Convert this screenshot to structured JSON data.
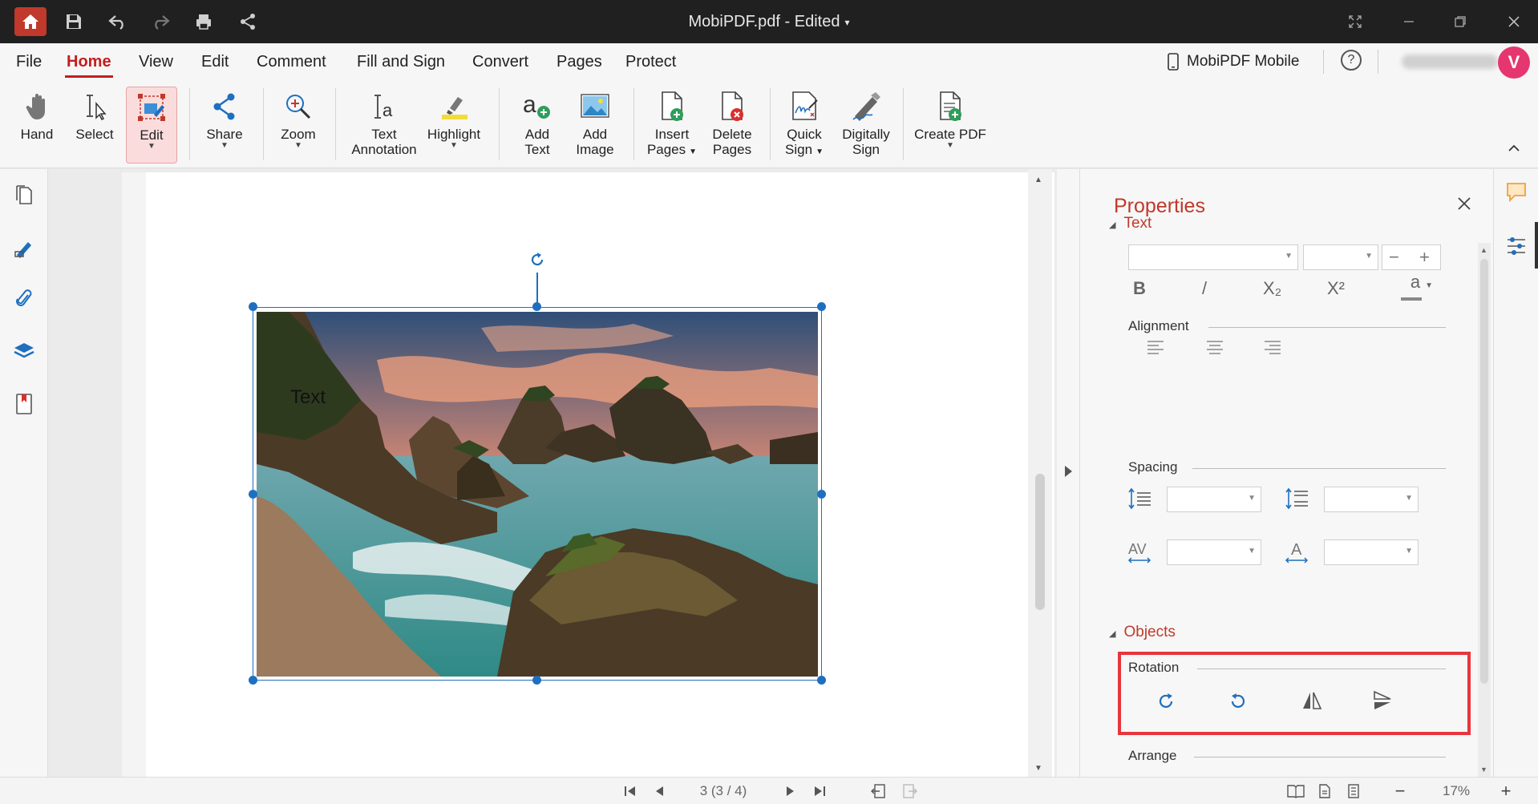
{
  "window": {
    "title": "MobiPDF.pdf - Edited",
    "title_caret": "▾"
  },
  "menu": {
    "tabs": [
      "File",
      "Home",
      "View",
      "Edit",
      "Comment",
      "Fill and Sign",
      "Convert",
      "Pages",
      "Protect"
    ],
    "active_tab": "Home",
    "mobile_label": "MobiPDF Mobile",
    "help_label": "?",
    "avatar_initial": "V"
  },
  "ribbon": {
    "hand": "Hand",
    "select": "Select",
    "edit": "Edit",
    "share": "Share",
    "zoom": "Zoom",
    "text_annotation_1": "Text",
    "text_annotation_2": "Annotation",
    "highlight": "Highlight",
    "add_text_1": "Add",
    "add_text_2": "Text",
    "add_image_1": "Add",
    "add_image_2": "Image",
    "insert_pages_1": "Insert",
    "insert_pages_2": "Pages",
    "delete_pages_1": "Delete",
    "delete_pages_2": "Pages",
    "quick_sign_1": "Quick",
    "quick_sign_2": "Sign",
    "digitally_sign_1": "Digitally",
    "digitally_sign_2": "Sign",
    "create_pdf": "Create PDF"
  },
  "document": {
    "overlay_text": "Text"
  },
  "properties": {
    "title": "Properties",
    "text_section": "Text",
    "bold": "B",
    "italic": "/",
    "subscript": "X₂",
    "superscript": "X²",
    "font_color": "a",
    "alignment": "Alignment",
    "spacing": "Spacing",
    "objects_section": "Objects",
    "rotation": "Rotation",
    "arrange": "Arrange",
    "minus": "−",
    "plus": "+"
  },
  "status": {
    "page_indicator": "3 (3 / 4)",
    "zoom": "17%",
    "zoom_minus": "−",
    "zoom_plus": "+"
  },
  "colors": {
    "accent": "#c0392b",
    "selection": "#1e6fbf",
    "highlight_box": "#e8353d"
  }
}
